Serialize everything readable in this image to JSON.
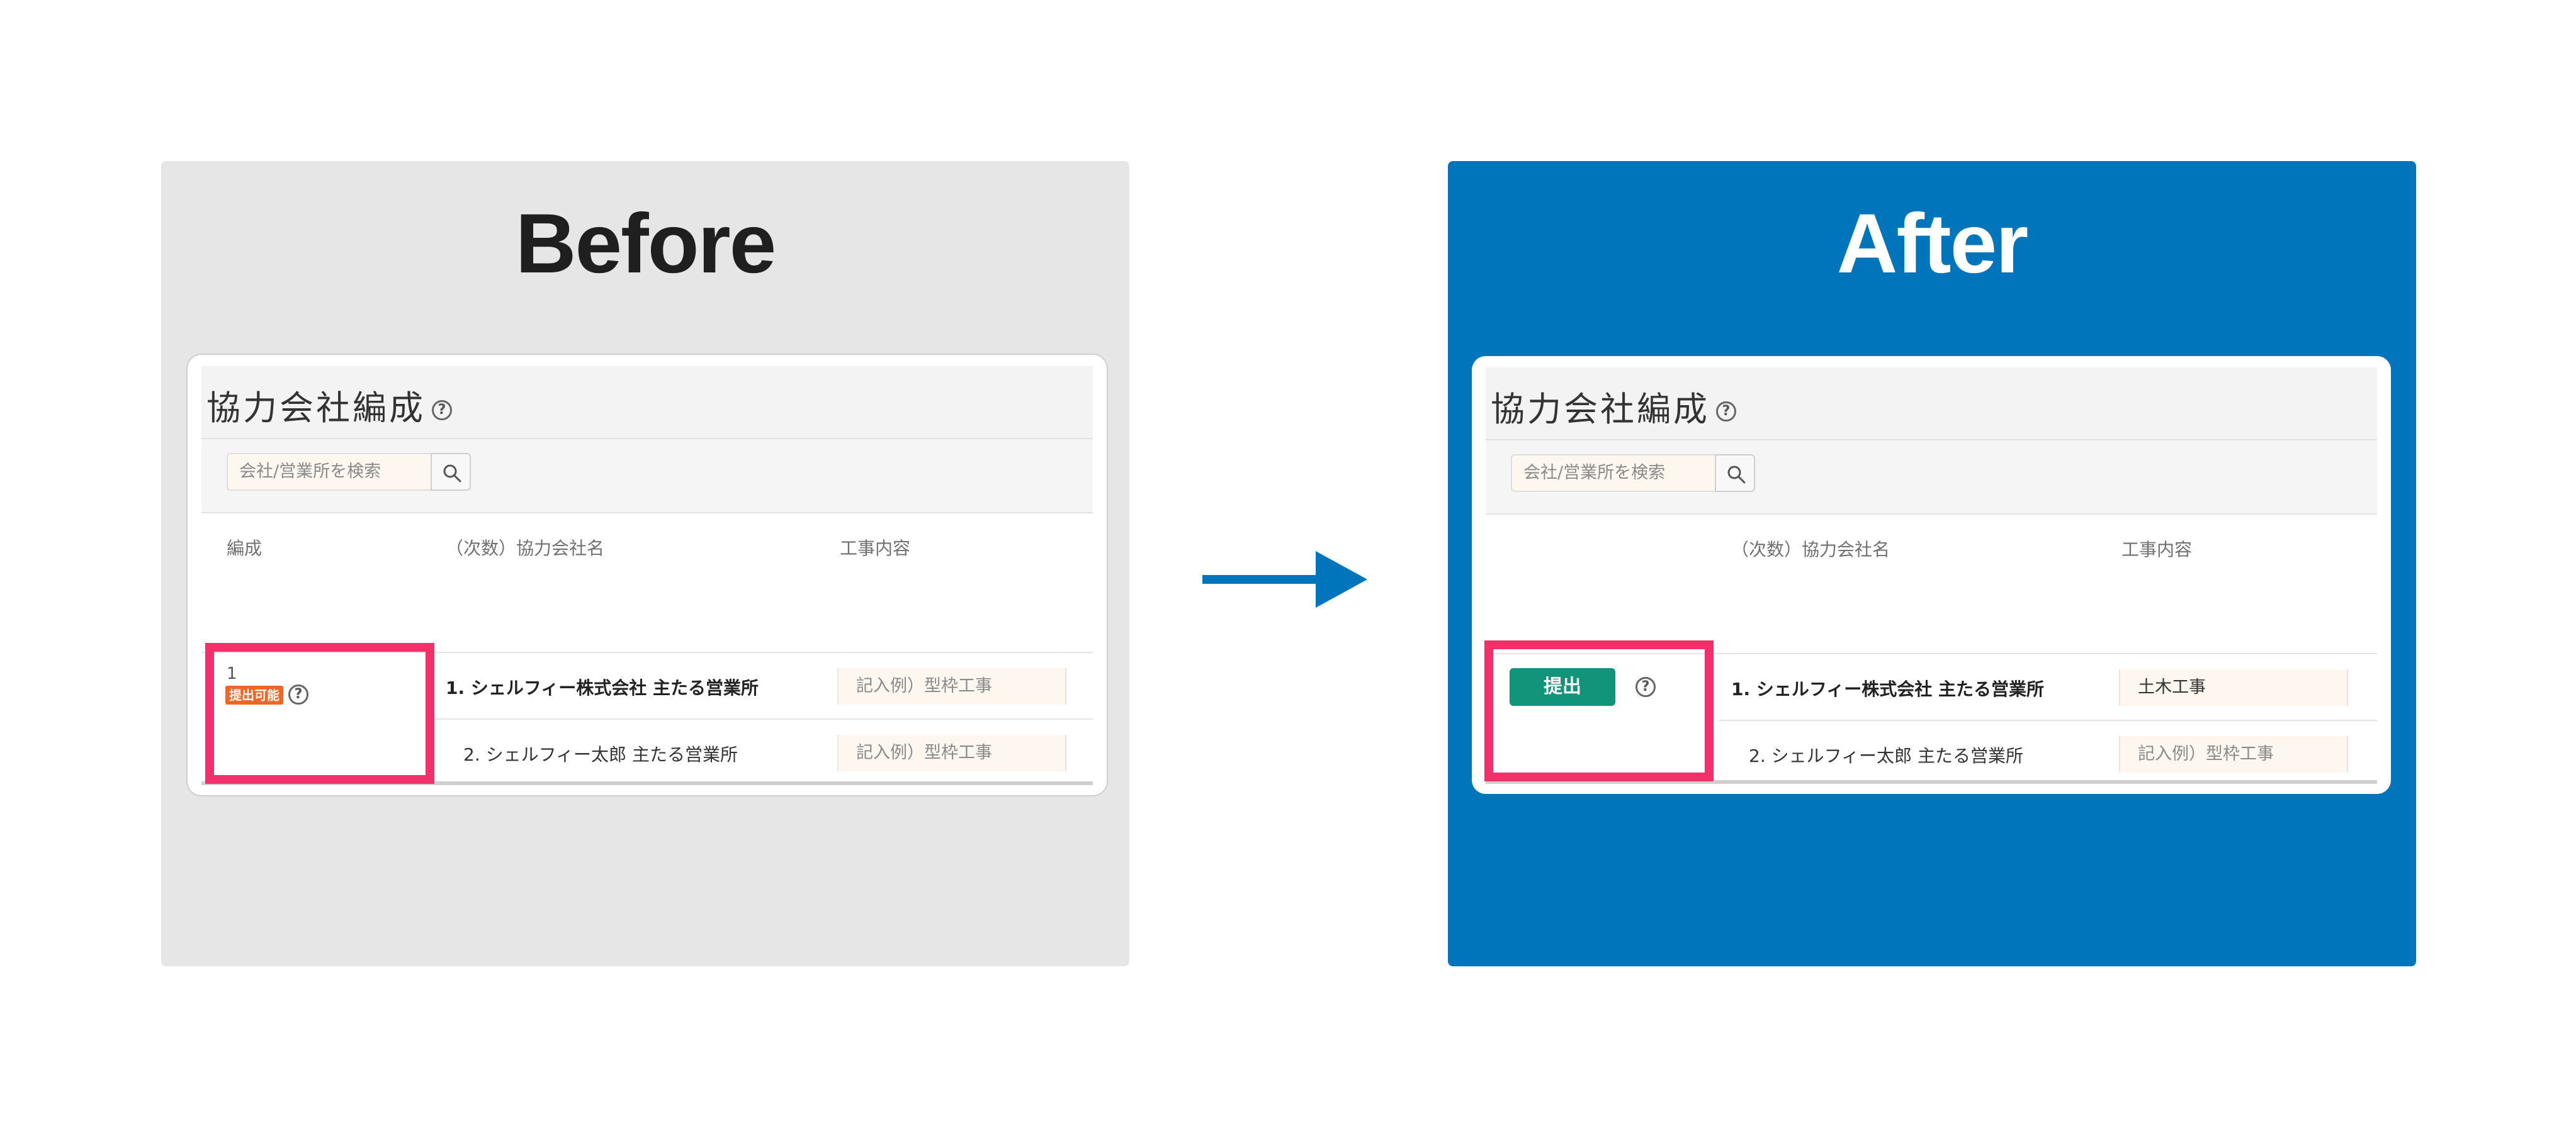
{
  "before": {
    "heading": "Before",
    "card": {
      "title": "協力会社編成",
      "help": "?",
      "search_placeholder": "会社/営業所を検索",
      "columns": {
        "group": "編成",
        "company": "（次数）協力会社名",
        "work": "工事内容"
      },
      "group_number": "1",
      "status_badge": "提出可能",
      "rows": [
        {
          "company": "1. シェルフィー株式会社 主たる営業所",
          "work": "記入例）型枠工事"
        },
        {
          "company": "2. シェルフィー太郎 主たる営業所",
          "work": "記入例）型枠工事"
        }
      ]
    }
  },
  "after": {
    "heading": "After",
    "card": {
      "title": "協力会社編成",
      "help": "?",
      "search_placeholder": "会社/営業所を検索",
      "columns": {
        "company": "（次数）協力会社名",
        "work": "工事内容"
      },
      "submit_label": "提出",
      "rows": [
        {
          "company": "1. シェルフィー株式会社 主たる営業所",
          "work": "土木工事"
        },
        {
          "company": "2. シェルフィー太郎 主たる営業所",
          "work": "記入例）型枠工事"
        }
      ]
    }
  },
  "colors": {
    "before_bg": "#e6e6e6",
    "after_bg": "#0075bc",
    "highlight": "#f2316b",
    "submit_button": "#12947a",
    "status_badge": "#f06624",
    "arrow": "#0075bc"
  },
  "icons": [
    "search-icon",
    "help-icon",
    "arrow-right-icon"
  ]
}
